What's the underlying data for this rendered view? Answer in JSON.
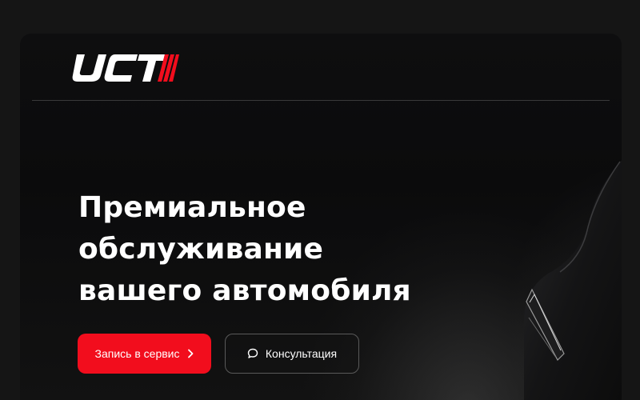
{
  "brand": {
    "logo_text": "UCT",
    "logo_icon": "logo-icon",
    "accent_color": "#f20d1d"
  },
  "hero": {
    "headline_lines": [
      "Премиальное",
      "обслуживание",
      "вашего автомобиля"
    ],
    "primary_button": {
      "label": "Запись в сервис",
      "icon": "chevron-right-icon"
    },
    "secondary_button": {
      "label": "Консультация",
      "icon": "chat-bubble-icon"
    }
  }
}
